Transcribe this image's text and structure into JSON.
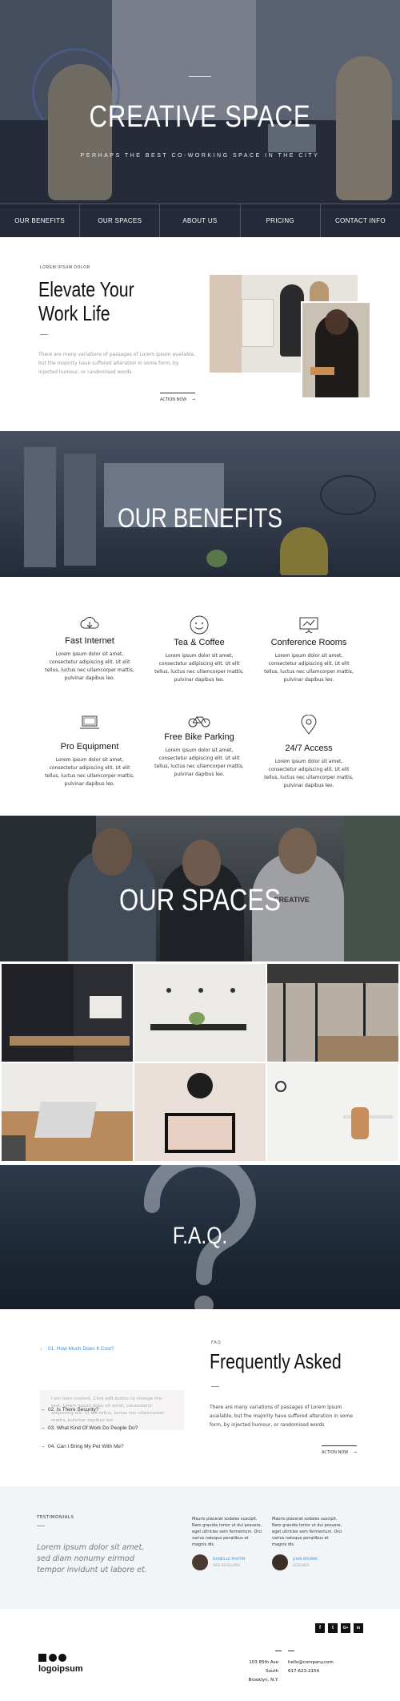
{
  "hero": {
    "title": "CREATIVE SPACE",
    "subtitle": "PERHAPS THE BEST CO-WORKING SPACE IN THE CITY",
    "nav": [
      "OUR BENEFITS",
      "OUR SPACES",
      "ABOUT US",
      "PRICING",
      "CONTACT INFO"
    ]
  },
  "intro": {
    "kicker": "LOREM IPSUM DOLOR",
    "title_line1": "Elevate Your",
    "title_line2": "Work Life",
    "text": "There are many variations of passages of Lorem Ipsum available, but the majority have suffered alteration in some form, by injected humour, or randomised words",
    "action": "ACTION NOW"
  },
  "benefits": {
    "title": "OUR BENEFITS",
    "items": [
      {
        "title": "Fast Internet",
        "text": "Lorem ipsum dolor sit amet, consectetur adipiscing elit. Ut elit tellus, luctus nec ullamcorper mattis, pulvinar dapibus leo.",
        "icon": "cloud-icon"
      },
      {
        "title": "Tea & Coffee",
        "text": "Lorem ipsum dolor sit amet, consectetur adipiscing elit. Ut elit tellus, luctus nec ullamcorper mattis, pulvinar dapibus leo.",
        "icon": "smiley-icon"
      },
      {
        "title": "Conference Rooms",
        "text": "Lorem ipsum dolor sit amet, consectetur adipiscing elit. Ut elit tellus, luctus nec ullamcorper mattis, pulvinar dapibus leo.",
        "icon": "presentation-icon"
      },
      {
        "title": "Pro Equipment",
        "text": "Lorem ipsum dolor sit amet, consectetur adipiscing elit. Ut elit tellus, luctus nec ullamcorper mattis, pulvinar dapibus leo.",
        "icon": "laptop-icon"
      },
      {
        "title": "Free Bike Parking",
        "text": "Lorem ipsum dolor sit amet, consectetur adipiscing elit. Ut elit tellus, luctus nec ullamcorper mattis, pulvinar dapibus leo.",
        "icon": "bike-icon"
      },
      {
        "title": "24/7 Access",
        "text": "Lorem ipsum dolor sit amet, consectetur adipiscing elit. Ut elit tellus, luctus nec ullamcorper mattis, pulvinar dapibus leo.",
        "icon": "location-pin-icon"
      }
    ]
  },
  "spaces": {
    "title": "OUR SPACES",
    "shirt_text": "CREATIVE"
  },
  "faq_banner": {
    "title": "F.A.Q."
  },
  "faq": {
    "kicker": "FAQ",
    "title": "Frequently Asked",
    "text": "There are many variations of passages of Lorem Ipsum available, but the majority have suffered alteration in some form, by injected humour, or randomised words",
    "action": "ACTION NOW",
    "questions": [
      {
        "label": "01. How Much Does It Cost?",
        "active": true
      },
      {
        "label": "02. Is There Security?",
        "active": false
      },
      {
        "label": "03. What Kind Of Work Do People Do?",
        "active": false
      },
      {
        "label": "04. Can I Bring My Pet With Me?",
        "active": false
      }
    ],
    "answer": "I am item content. Click edit button to change this text. Lorem ipsum dolor sit amet, consectetur adipiscing elit. Ut elit tellus, luctus nec ullamcorper mattis, pulvinar dapibus leo."
  },
  "testimonials": {
    "kicker": "TESTIMONIALS",
    "quote": "Lorem ipsum dolor sit amet, sed diam nonumy eirmod tempor invidunt ut labore et.",
    "cards": [
      {
        "text": "Mauris placerat sodales suscipit. Nam gravida tortor ut dui posuere, eget ultricies sem fermentum. Orci varius natoque penatibus et magnis dis.",
        "name": "DANIELLE MARTIN",
        "role": "WEB DEVELOPER"
      },
      {
        "text": "Mauris placerat sodales suscipit. Nam gravida tortor ut dui posuere, eget ultricies sem fermentum. Orci varius natoque penatibus et magnis dis.",
        "name": "JOHN BROWN",
        "role": "DESIGNER"
      }
    ]
  },
  "footer": {
    "social": [
      "f",
      "t",
      "G+",
      "in"
    ],
    "logo": "logoipsum",
    "address_line1": "103 85th Ave South",
    "address_line2": "Brooklyn, N.Y.",
    "email": "hello@company.com",
    "phone": "617-623-2154"
  }
}
